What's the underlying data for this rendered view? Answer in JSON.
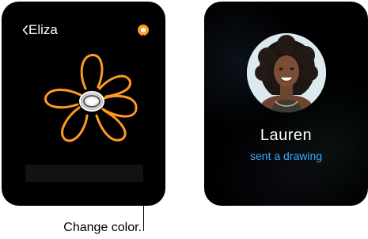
{
  "left_watch": {
    "back_label": "Eliza",
    "selected_color": "#ff9a1f",
    "drawing": "flower"
  },
  "right_watch": {
    "contact_name": "Lauren",
    "status": "sent a drawing",
    "status_color": "#39a9ff"
  },
  "callout": {
    "label": "Change color."
  }
}
